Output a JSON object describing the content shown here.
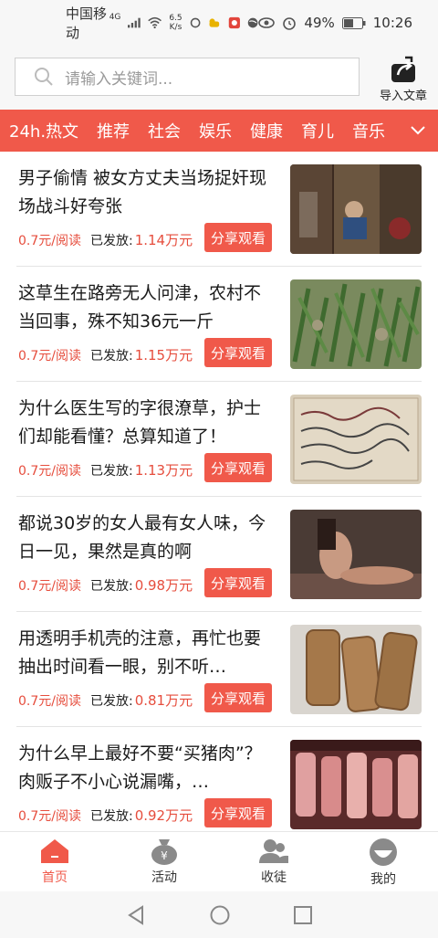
{
  "status_bar": {
    "carrier": "中国移动",
    "network_tag": "4G",
    "speed_value": "6.5",
    "speed_unit": "K/s",
    "battery": "49%",
    "time": "10:26"
  },
  "header": {
    "search_placeholder": "请输入关键词...",
    "import_label": "导入文章"
  },
  "tabs": [
    "24h.热文",
    "推荐",
    "社会",
    "娱乐",
    "健康",
    "育儿",
    "音乐"
  ],
  "feed": [
    {
      "title": "男子偷情 被女方丈夫当场捉奸现场战斗好夸张",
      "rate": "0.7元/阅读",
      "sent_label": "已发放:",
      "sent_value": "1.14万元",
      "share_label": "分享观看",
      "thumb": "dark-room-scene"
    },
    {
      "title": "这草生在路旁无人问津，农村不当回事，殊不知36元一斤",
      "rate": "0.7元/阅读",
      "sent_label": "已发放:",
      "sent_value": "1.15万元",
      "share_label": "分享观看",
      "thumb": "green-grass"
    },
    {
      "title": "为什么医生写的字很潦草，护士们却能看懂？总算知道了！",
      "rate": "0.7元/阅读",
      "sent_label": "已发放:",
      "sent_value": "1.13万元",
      "share_label": "分享观看",
      "thumb": "handwritten-prescription"
    },
    {
      "title": "都说30岁的女人最有女人味，今日一见，果然是真的啊",
      "rate": "0.7元/阅读",
      "sent_label": "已发放:",
      "sent_value": "0.98万元",
      "share_label": "分享观看",
      "thumb": "woman-photo"
    },
    {
      "title": "用透明手机壳的注意，再忙也要抽出时间看一眼，别不听…",
      "rate": "0.7元/阅读",
      "sent_label": "已发放:",
      "sent_value": "0.81万元",
      "share_label": "分享观看",
      "thumb": "phone-cases"
    },
    {
      "title": "为什么早上最好不要“买猪肉”？肉贩子不小心说漏嘴，…",
      "rate": "0.7元/阅读",
      "sent_label": "已发放:",
      "sent_value": "0.92万元",
      "share_label": "分享观看",
      "thumb": "pork-stall"
    }
  ],
  "bottom_nav": [
    {
      "label": "首页",
      "icon": "home-icon",
      "active": true
    },
    {
      "label": "活动",
      "icon": "money-bag-icon",
      "active": false
    },
    {
      "label": "收徒",
      "icon": "users-icon",
      "active": false
    },
    {
      "label": "我的",
      "icon": "profile-icon",
      "active": false
    }
  ],
  "colors": {
    "accent": "#f0594a",
    "price": "#e64d3d"
  }
}
